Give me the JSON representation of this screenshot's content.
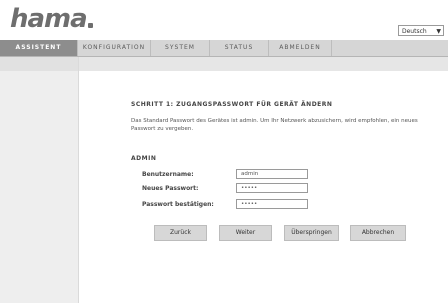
{
  "header": {
    "logo_text": "hama",
    "language": "Deutsch"
  },
  "nav": {
    "tabs": [
      {
        "label": "ASSISTENT",
        "active": true
      },
      {
        "label": "KONFIGURATION",
        "active": false
      },
      {
        "label": "SYSTEM",
        "active": false
      },
      {
        "label": "STATUS",
        "active": false
      },
      {
        "label": "ABMELDEN",
        "active": false
      }
    ]
  },
  "main": {
    "step_title": "SCHRITT 1: ZUGANGSPASSWORT FÜR GERÄT ÄNDERN",
    "description": "Das Standard Passwort des Gerätes ist admin. Um Ihr Netzwerk abzusichern, wird empfohlen, ein neues Passwort zu vergeben.",
    "section_title": "ADMIN",
    "fields": {
      "username": {
        "label": "Benutzername:",
        "value": "admin"
      },
      "new_password": {
        "label": "Neues Passwort:",
        "value": "•••••"
      },
      "confirm_password": {
        "label": "Passwort bestätigen:",
        "value": "•••••"
      }
    },
    "buttons": {
      "back": "Zurück",
      "next": "Weiter",
      "skip": "Überspringen",
      "cancel": "Abbrechen"
    }
  },
  "colors": {
    "active_tab": "#8d8d8d",
    "nav_background": "#d6d6d6",
    "sidebar": "#eeeeee",
    "button": "#d7d7d7"
  }
}
